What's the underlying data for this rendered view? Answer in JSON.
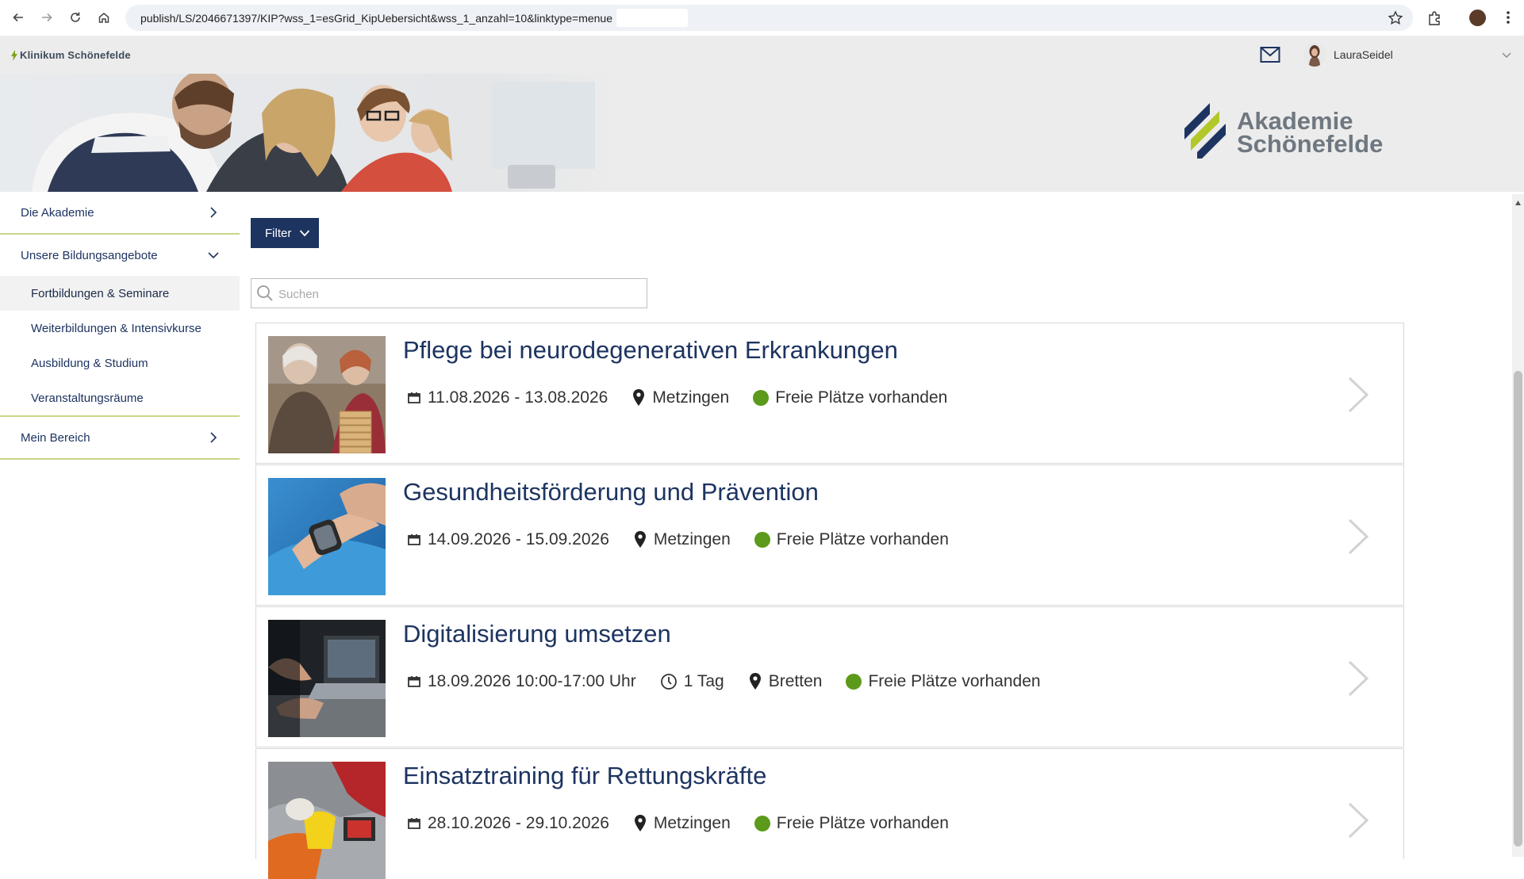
{
  "browser": {
    "url": "publish/LS/2046671397/KIP?wss_1=esGrid_KipUebersicht&wss_1_anzahl=10&linktype=menue"
  },
  "site": {
    "brand": "Klinikum Schönefelde",
    "username": "LauraSeidel",
    "logo_line1": "Akademie",
    "logo_line2": "Schönefelde",
    "colors": {
      "primary": "#1d3461",
      "accent_green": "#c6d68a",
      "available": "#5b9a1a"
    }
  },
  "sidebar": {
    "top1": "Die Akademie",
    "top2": "Unsere Bildungsangebote",
    "sub": [
      "Fortbildungen & Seminare",
      "Weiterbildungen & Intensivkurse",
      "Ausbildung & Studium",
      "Veranstaltungsräume"
    ],
    "top3": "Mein Bereich"
  },
  "main": {
    "filter_label": "Filter",
    "search_placeholder": "Suchen",
    "courses": [
      {
        "title": "Pflege bei neurodegenerativen Erkrankungen",
        "date": "11.08.2026 - 13.08.2026",
        "location": "Metzingen",
        "status": "Freie Plätze vorhanden"
      },
      {
        "title": "Gesundheitsförderung und Prävention",
        "date": "14.09.2026 - 15.09.2026",
        "location": "Metzingen",
        "status": "Freie Plätze vorhanden"
      },
      {
        "title": "Digitalisierung umsetzen",
        "date": "18.09.2026 10:00-17:00 Uhr",
        "duration": "1 Tag",
        "location": "Bretten",
        "status": "Freie Plätze vorhanden"
      },
      {
        "title": "Einsatztraining für Rettungskräfte",
        "date": "28.10.2026 - 29.10.2026",
        "location": "Metzingen",
        "status": "Freie Plätze vorhanden"
      }
    ]
  }
}
